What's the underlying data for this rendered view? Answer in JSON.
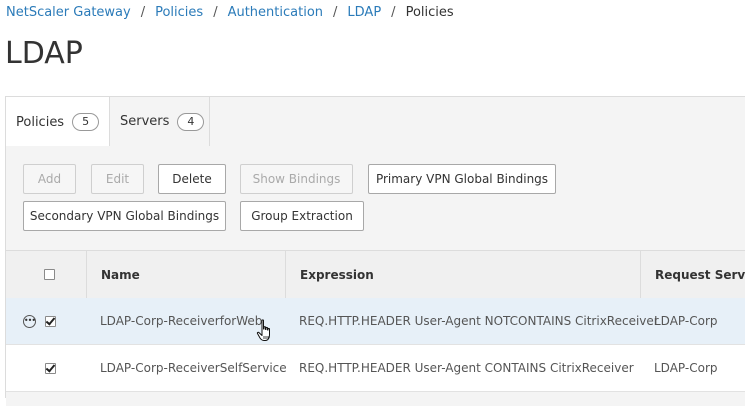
{
  "breadcrumb": {
    "items": [
      "NetScaler Gateway",
      "Policies",
      "Authentication",
      "LDAP"
    ],
    "current": "Policies",
    "separator": "/"
  },
  "page": {
    "title": "LDAP"
  },
  "tabs": [
    {
      "label": "Policies",
      "count": "5",
      "active": true
    },
    {
      "label": "Servers",
      "count": "4",
      "active": false
    }
  ],
  "toolbar": {
    "add": "Add",
    "edit": "Edit",
    "delete": "Delete",
    "show_bindings": "Show Bindings",
    "primary_vpn": "Primary VPN Global Bindings",
    "secondary_vpn": "Secondary VPN Global Bindings",
    "group_extraction": "Group Extraction"
  },
  "table": {
    "columns": [
      "Name",
      "Expression",
      "Request Server"
    ],
    "rows": [
      {
        "name": "LDAP-Corp-ReceiverforWeb",
        "expression": "REQ.HTTP.HEADER User-Agent NOTCONTAINS CitrixReceiver",
        "server": "LDAP-Corp",
        "checked": true
      },
      {
        "name": "LDAP-Corp-ReceiverSelfService",
        "expression": "REQ.HTTP.HEADER User-Agent CONTAINS CitrixReceiver",
        "server": "LDAP-Corp",
        "checked": true
      }
    ]
  },
  "icons": {
    "more": "more-options-icon",
    "cursor": "hand-pointer-icon"
  },
  "colors": {
    "link": "#2b7bb9",
    "row_hover": "#e7f0f8"
  }
}
